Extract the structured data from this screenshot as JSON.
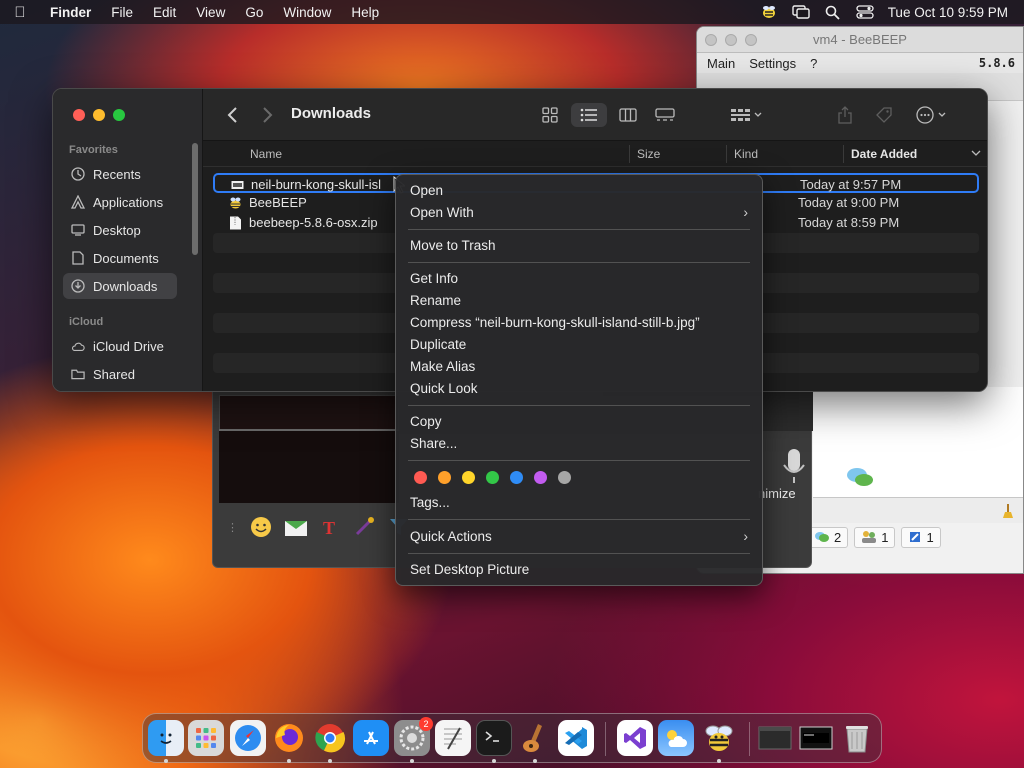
{
  "menubar": {
    "app": "Finder",
    "items": [
      "File",
      "Edit",
      "View",
      "Go",
      "Window",
      "Help"
    ],
    "clock": "Tue Oct 10  9:59 PM"
  },
  "beebeep": {
    "title": "vm4 - BeeBEEP",
    "menu": [
      "Main",
      "Settings",
      "?"
    ],
    "version": "5.8.6",
    "minimize_label": "nimize",
    "status_counts": [
      "2",
      "2",
      "1",
      "1"
    ]
  },
  "finder": {
    "title": "Downloads",
    "sidebar": {
      "favorites_header": "Favorites",
      "favorites": [
        {
          "label": "Recents",
          "icon": "clock-icon"
        },
        {
          "label": "Applications",
          "icon": "applications-icon"
        },
        {
          "label": "Desktop",
          "icon": "desktop-icon"
        },
        {
          "label": "Documents",
          "icon": "document-icon"
        },
        {
          "label": "Downloads",
          "icon": "download-icon",
          "active": true
        }
      ],
      "icloud_header": "iCloud",
      "icloud": [
        {
          "label": "iCloud Drive",
          "icon": "cloud-icon"
        },
        {
          "label": "Shared",
          "icon": "shared-folder-icon"
        }
      ]
    },
    "columns": {
      "name": "Name",
      "size": "Size",
      "kind": "Kind",
      "date_added": "Date Added"
    },
    "files": [
      {
        "name": "neil-burn-kong-skull-isl",
        "date_added": "Today at 9:57 PM",
        "icon": "image-file-icon",
        "selected": true
      },
      {
        "name": "BeeBEEP",
        "date_added": "Today at 9:00 PM",
        "icon": "beebeep-app-icon"
      },
      {
        "name": "beebeep-5.8.6-osx.zip",
        "date_added": "Today at 8:59 PM",
        "icon": "zip-file-icon"
      }
    ]
  },
  "context_menu": {
    "open": "Open",
    "open_with": "Open With",
    "move_to_trash": "Move to Trash",
    "get_info": "Get Info",
    "rename": "Rename",
    "compress": "Compress “neil-burn-kong-skull-island-still-b.jpg”",
    "duplicate": "Duplicate",
    "make_alias": "Make Alias",
    "quick_look": "Quick Look",
    "copy": "Copy",
    "share": "Share...",
    "tag_colors": [
      "#ff5a52",
      "#ffa02a",
      "#ffd52a",
      "#33c748",
      "#2f8cf6",
      "#c25cf0",
      "#a6a6a6"
    ],
    "tags": "Tags...",
    "quick_actions": "Quick Actions",
    "set_desktop_picture": "Set Desktop Picture"
  },
  "dock": {
    "apps": [
      "Finder",
      "Launchpad",
      "Safari",
      "Firefox",
      "Chrome",
      "App Store",
      "System Settings",
      "TextEdit",
      "Terminal",
      "Instruments",
      "VS Code",
      "Visual Studio",
      "Weather",
      "BeeBEEP",
      "Window 1",
      "Window 2",
      "Trash"
    ],
    "settings_badge": "2"
  }
}
